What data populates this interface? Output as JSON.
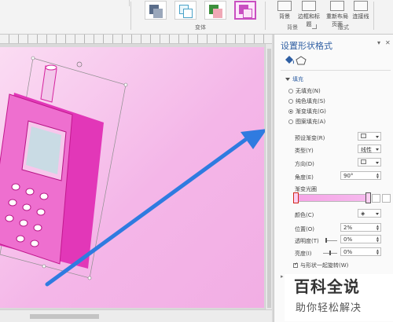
{
  "ribbon": {
    "groups": {
      "shape_styles_label": "变体",
      "background_label": "背景",
      "layout_label": "版式"
    },
    "buttons": {
      "background": "背景",
      "rich_title": "边框和标题",
      "relayout_line1": "重新布局",
      "relayout_line2": "页面",
      "connectors": "连接线"
    }
  },
  "pane": {
    "title": "设置形状格式",
    "fill_section": "填充",
    "fill_options": [
      "无填充(N)",
      "纯色填充(S)",
      "渐变填充(G)",
      "图案填充(A)"
    ],
    "fill_selected_index": 2,
    "preset_label": "预设渐变(R)",
    "type_label": "类型(Y)",
    "type_value": "线性",
    "direction_label": "方向(D)",
    "angle_label": "角度(E)",
    "angle_value": "90°",
    "stops_label": "渐变光圈",
    "color_label": "颜色(C)",
    "position_label": "位置(O)",
    "position_value": "2%",
    "transparency_label": "透明度(T)",
    "transparency_value": "0%",
    "brightness_label": "亮度(I)",
    "brightness_value": "0%",
    "rotate_with_shape": "与形状一起旋转(W)",
    "rotate_checked": true
  },
  "watermark": {
    "title": "百科全说",
    "subtitle": "助你轻松解决"
  },
  "colors": {
    "accent": "#2f5fa3",
    "arrow": "#2f7be0",
    "phone": "#d6249f",
    "slide": "#f4b6e8"
  }
}
